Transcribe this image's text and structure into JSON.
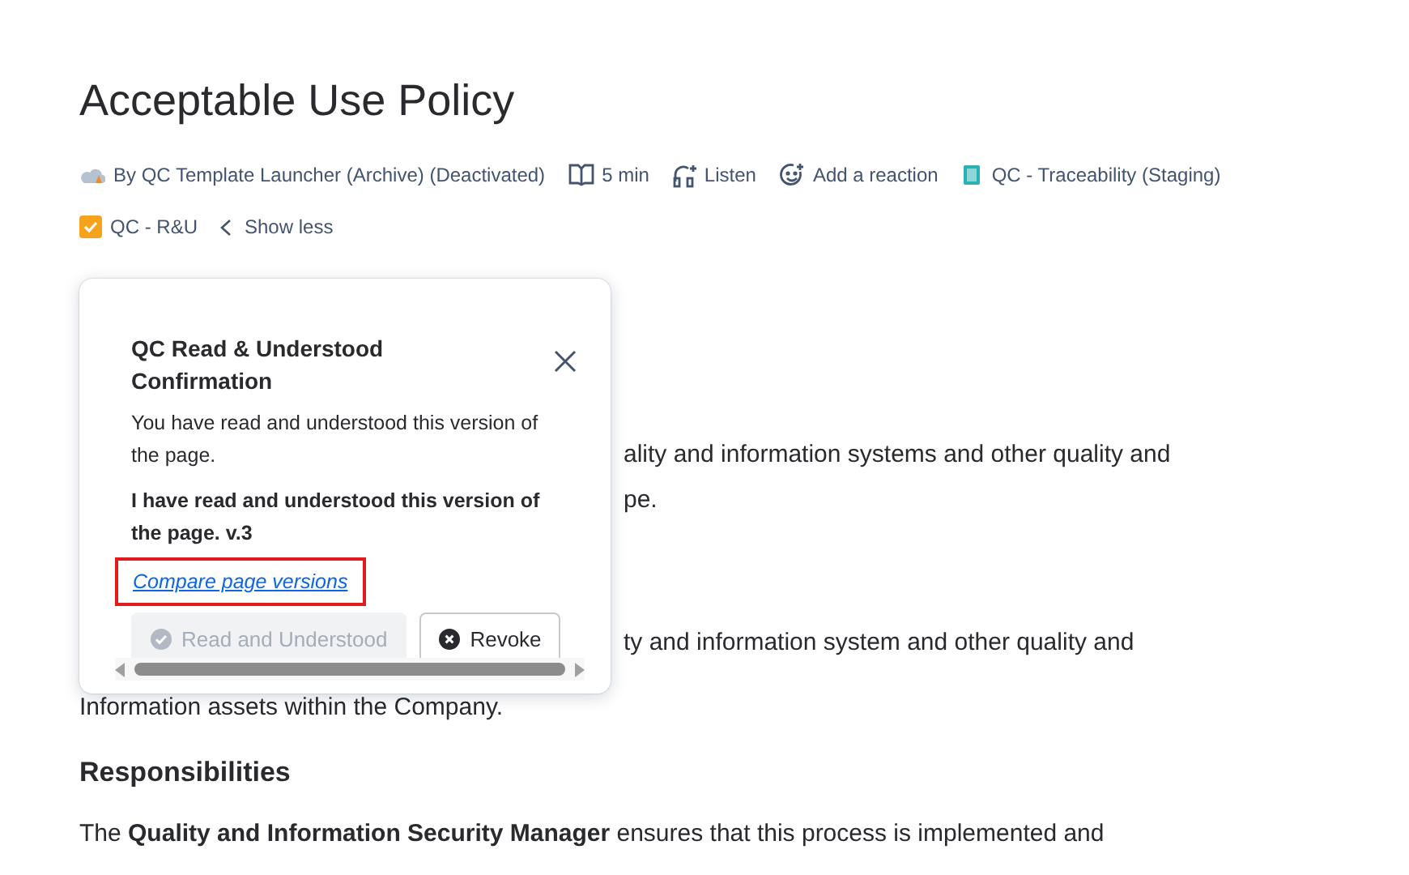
{
  "page": {
    "title": "Acceptable Use Policy"
  },
  "meta": [
    {
      "kind": "author",
      "text": "By QC Template Launcher (Archive) (Deactivated)"
    },
    {
      "kind": "read_time",
      "text": "5 min"
    },
    {
      "kind": "listen",
      "text": "Listen"
    },
    {
      "kind": "reaction",
      "text": "Add a reaction"
    },
    {
      "kind": "space",
      "text": "QC - Traceability (Staging)"
    }
  ],
  "meta_row_2": [
    {
      "kind": "label",
      "text": "QC - R&U"
    },
    {
      "kind": "toggle",
      "text": "Show less"
    }
  ],
  "body_fragments": [
    {
      "kind": "indent",
      "lines": [
        "ality and information systems and other quality and",
        "pe."
      ]
    },
    {
      "kind": "indent",
      "lines": [
        "ty and information system and other quality and"
      ]
    },
    {
      "kind": "full",
      "lines": [
        "Information assets within the Company."
      ]
    }
  ],
  "section": {
    "heading": "Responsibilities",
    "paragraph": "The **Quality and Information Security Manager** ensures that this process is implemented and"
  },
  "popover": {
    "title": "QC Read & Understood Confirmation",
    "message": "You have read and understood this version of the page.",
    "confirmation": "I have read and understood this version of the page. v.3",
    "link": {
      "text": "Compare page versions",
      "highlighted": true
    },
    "buttons": [
      {
        "label": "Read and Understood",
        "disabled": true,
        "kind": "confirm"
      },
      {
        "label": "Revoke",
        "disabled": false,
        "kind": "revoke"
      }
    ]
  }
}
